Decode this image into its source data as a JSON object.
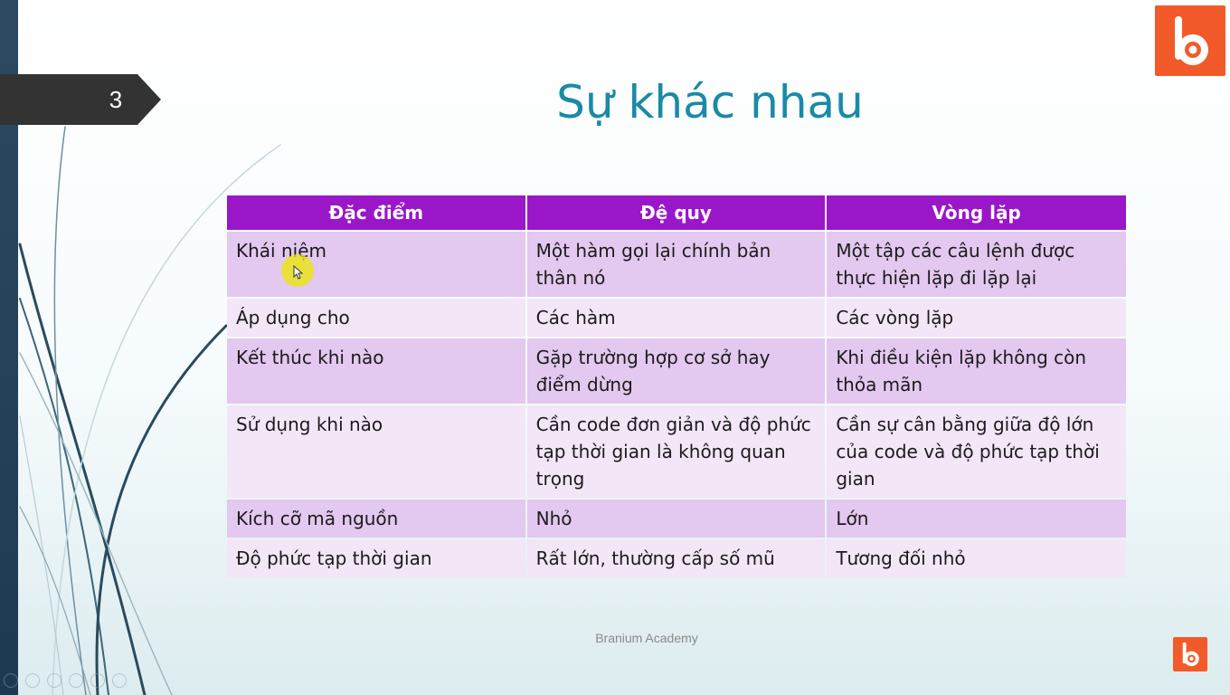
{
  "slide": {
    "number": "3",
    "title": "Sự khác nhau",
    "footer": "Branium Academy"
  },
  "table": {
    "headers": [
      "Đặc điểm",
      "Đệ quy",
      "Vòng lặp"
    ],
    "rows": [
      [
        "Khái niệm",
        "Một hàm gọi lại chính bản thân nó",
        "Một tập các câu lệnh được thực hiện lặp đi lặp lại"
      ],
      [
        "Áp dụng cho",
        "Các hàm",
        "Các vòng lặp"
      ],
      [
        "Kết thúc khi nào",
        "Gặp trường hợp cơ sở hay điểm dừng",
        "Khi điều kiện lặp không còn thỏa mãn"
      ],
      [
        "Sử dụng khi nào",
        "Cần code đơn giản và độ phức tạp thời gian là không quan trọng",
        "Cần sự cân bằng giữa độ lớn của code và độ phức tạp thời gian"
      ],
      [
        "Kích cỡ mã nguồn",
        "Nhỏ",
        "Lớn"
      ],
      [
        "Độ phức tạp thời gian",
        "Rất lớn, thường cấp số mũ",
        "Tương đối nhỏ"
      ]
    ]
  },
  "icons": {
    "logo": "branium-logo-icon",
    "watermark": "branium-watermark-icon",
    "pointer": "laser-pointer-icon"
  },
  "colors": {
    "header_bg": "#9a16c9",
    "row_odd": "#e3c8ef",
    "row_even": "#f2e6f7",
    "title": "#1a8aa6",
    "logo": "#f35a2a",
    "tab": "#333333"
  }
}
